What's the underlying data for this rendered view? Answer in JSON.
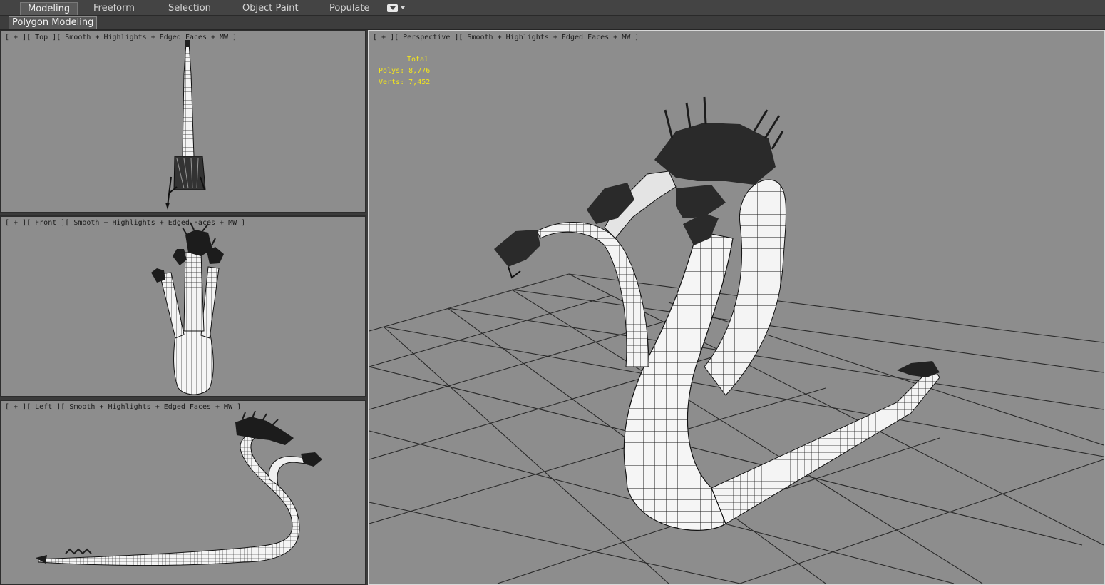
{
  "ribbon": {
    "tabs": [
      {
        "label": "Modeling",
        "active": true
      },
      {
        "label": "Freeform",
        "active": false
      },
      {
        "label": "Selection",
        "active": false
      },
      {
        "label": "Object Paint",
        "active": false
      },
      {
        "label": "Populate",
        "active": false
      }
    ],
    "menu_icon": "dropdown-box-icon"
  },
  "subbar": {
    "active_panel": "Polygon Modeling"
  },
  "viewports": {
    "top": {
      "label": "[ + ][ Top ][ Smooth + Highlights + Edged Faces + MW ]"
    },
    "front": {
      "label": "[ + ][ Front ][ Smooth + Highlights + Edged Faces + MW ]"
    },
    "left": {
      "label": "[ + ][ Left ][ Smooth + Highlights + Edged Faces + MW ]"
    },
    "perspective": {
      "label": "[ + ][ Perspective ][ Smooth + Highlights + Edged Faces + MW ]",
      "stats": {
        "total_label": "Total",
        "polys_label": "Polys:",
        "polys_value": "8,776",
        "verts_label": "Verts:",
        "verts_value": "7,452"
      }
    }
  },
  "colors": {
    "viewport_bg": "#8d8d8d",
    "stats_text": "#f3e51c",
    "ribbon_bg": "#444444",
    "active_border": "#d8d8d8"
  }
}
